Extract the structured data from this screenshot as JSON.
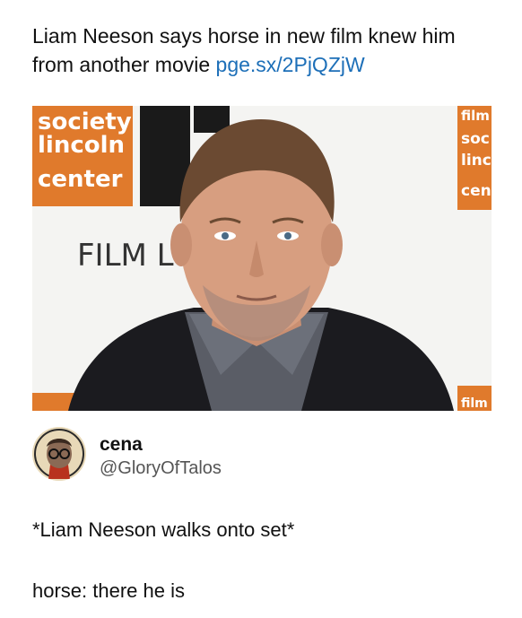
{
  "post": {
    "line1": "Liam Neeson says horse in new film knew him",
    "line2_prefix": "from another movie ",
    "link": "pge.sx/2PjQZjW"
  },
  "photo": {
    "sign_left_lines": [
      "society",
      "lincoln",
      "center"
    ],
    "sign_right_lines": [
      "film",
      "soc",
      "linc",
      "cen"
    ],
    "banner_text": "FILM L",
    "bottom_right_text": "film"
  },
  "tweet": {
    "name": "cena",
    "handle": "@GloryOfTalos",
    "line1": "*Liam Neeson walks onto set*",
    "line2": "horse: there he is"
  },
  "colors": {
    "text": "#111111",
    "link": "#1d6fb8",
    "sign_orange": "#e07a2c",
    "handle": "#555555"
  }
}
